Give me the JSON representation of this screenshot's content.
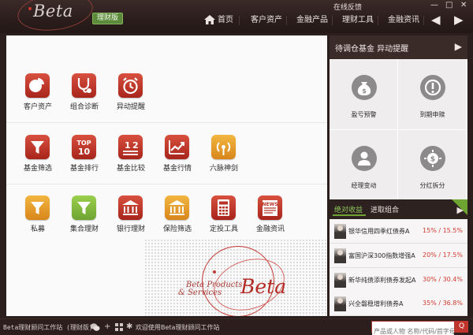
{
  "app": {
    "logo": "Beta",
    "badge": "理财版",
    "feedback": "在线反馈",
    "window_controls": [
      "—",
      "□",
      "✕"
    ]
  },
  "nav": {
    "items": [
      "首页",
      "客户资产",
      "金融产品",
      "理财工具",
      "金融资讯"
    ],
    "back": "◀",
    "forward": "▶"
  },
  "tiles": [
    {
      "label": "客户资产",
      "icon": "pie-chart-icon",
      "color": "red"
    },
    {
      "label": "组合诊断",
      "icon": "stethoscope-icon",
      "color": "red"
    },
    {
      "label": "异动提醒",
      "icon": "alarm-clock-icon",
      "color": "red"
    },
    {
      "label": "基金筛选",
      "icon": "funnel-icon",
      "color": "red"
    },
    {
      "label": "基金排行",
      "icon": "top10-icon",
      "color": "red"
    },
    {
      "label": "基金比较",
      "icon": "compare-icon",
      "color": "red"
    },
    {
      "label": "基金行情",
      "icon": "trend-chart-icon",
      "color": "red"
    },
    {
      "label": "六脉神剑",
      "icon": "signal-icon",
      "color": "orange"
    },
    {
      "label": "私募",
      "icon": "funnel-icon",
      "color": "orange"
    },
    {
      "label": "集合理财",
      "icon": "funnel-icon",
      "color": "green"
    },
    {
      "label": "银行理财",
      "icon": "bank-icon",
      "color": "red"
    },
    {
      "label": "保险筛选",
      "icon": "bank-icon",
      "color": "orange"
    },
    {
      "label": "定投工具",
      "icon": "calculator-icon",
      "color": "red"
    },
    {
      "label": "金融资讯",
      "icon": "news-icon",
      "color": "red"
    }
  ],
  "brand": {
    "line1": "Beta Products",
    "line2": "& Services",
    "logo": "Beta"
  },
  "alerts_panel": {
    "title": "待调仓基金  异动提醒",
    "arrow": "▶",
    "items": [
      {
        "label": "盈亏预警",
        "icon": "money-bag-icon"
      },
      {
        "label": "到期申赎",
        "icon": "warning-icon"
      },
      {
        "label": "经理变动",
        "icon": "manager-icon"
      },
      {
        "label": "分红拆分",
        "icon": "dividend-icon"
      }
    ]
  },
  "ranking_panel": {
    "tab_active": "绝对收益",
    "tab_inactive": "进取组合",
    "arrow": "▶",
    "funds": [
      {
        "name": "银华信用四季红债券A",
        "pct": "15% / 15.5%"
      },
      {
        "name": "富国沪深300指数增强A",
        "pct": "20% / 17.5%"
      },
      {
        "name": "新华纯债添利债券发起A",
        "pct": "30% / 30.4%"
      },
      {
        "name": "兴全磐稳增利债券A",
        "pct": "35% / 36.8%"
      }
    ]
  },
  "status": {
    "station": "Beta理财顾问工作站 (理财版)",
    "welcome": "欢迎使用Beta理财顾问工作站",
    "search_placeholder": "产品或人物 名称/代码/首字母",
    "search_button": "Q",
    "icons": [
      "wechat-icon",
      "plus-icon",
      "grid-icon",
      "settings-icon"
    ]
  },
  "colors": {
    "red": "#c2352c",
    "orange": "#e59a28",
    "green": "#6ea532",
    "dark": "#2b1f1d"
  }
}
